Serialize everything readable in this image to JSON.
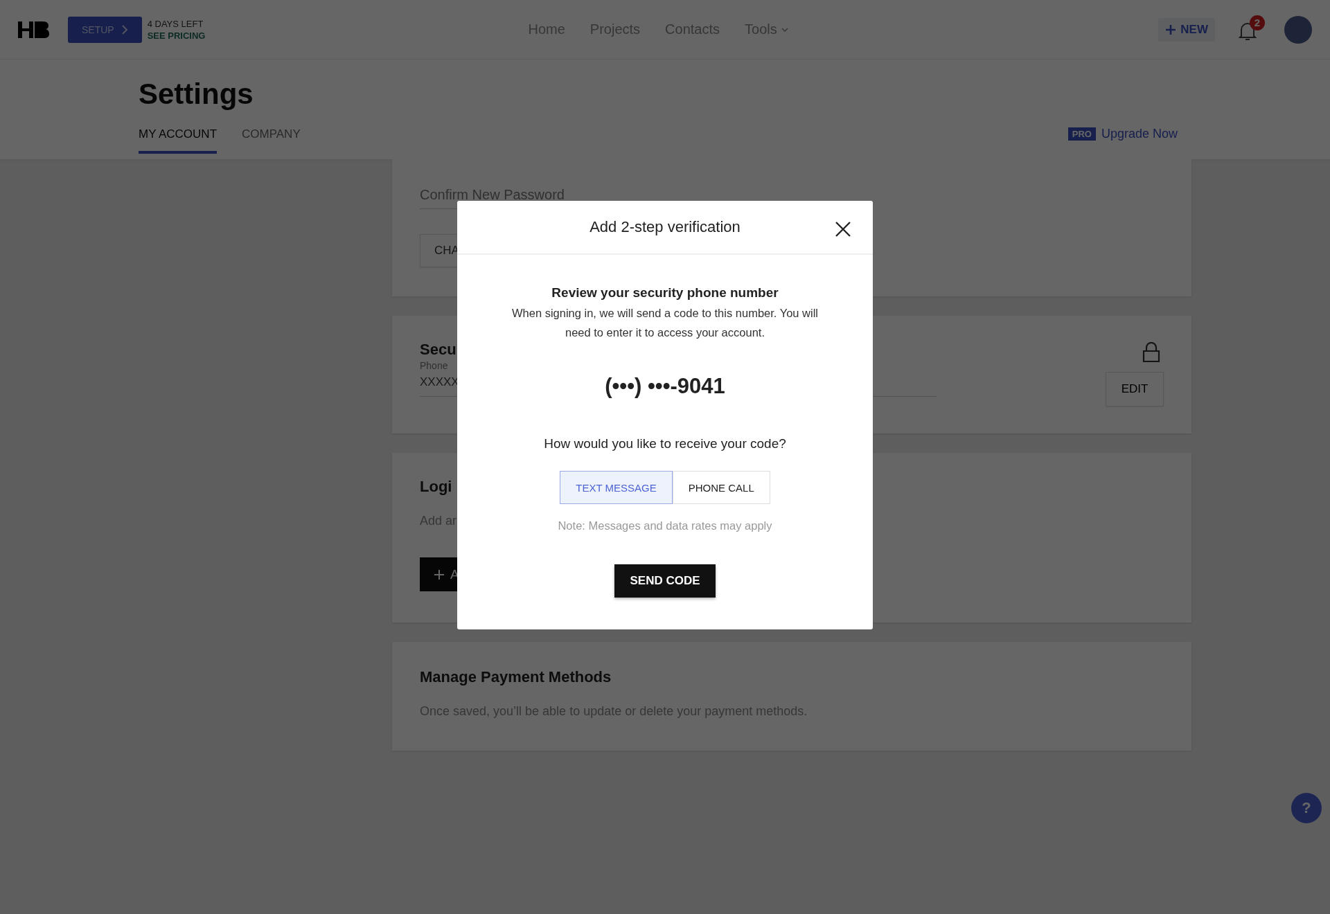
{
  "header": {
    "setup_button": "SETUP",
    "trial": {
      "days_left": "4 DAYS LEFT",
      "pricing_link": "SEE PRICING"
    },
    "nav": [
      {
        "label": "Home",
        "has_menu": false
      },
      {
        "label": "Projects",
        "has_menu": false
      },
      {
        "label": "Contacts",
        "has_menu": false
      },
      {
        "label": "Tools",
        "has_menu": true
      }
    ],
    "new_button": "NEW",
    "notifications_badge": "2"
  },
  "page": {
    "title": "Settings",
    "tabs": [
      {
        "label": "MY ACCOUNT",
        "selected": true
      },
      {
        "label": "COMPANY",
        "selected": false
      }
    ],
    "upgrade": {
      "badge": "PRO",
      "link": "Upgrade Now"
    }
  },
  "password_card": {
    "field_placeholder": "Confirm New Password",
    "button": "CHA"
  },
  "security_card": {
    "title": "Secu",
    "field_label": "Phone",
    "value": "XXXXX",
    "edit_button": "EDIT"
  },
  "login_card": {
    "title": "Logi",
    "description": "Add ar",
    "button": "A"
  },
  "payment_card": {
    "title": "Manage Payment Methods",
    "description": "Once saved, you’ll be able to update or delete your payment methods."
  },
  "modal": {
    "title": "Add 2-step verification",
    "heading": "Review your security phone number",
    "description": "When signing in, we will send a code to this number. You will need to enter it to access your account.",
    "phone": "(•••) •••-9041",
    "question": "How would you like to receive your code?",
    "options": [
      {
        "label": "TEXT MESSAGE",
        "selected": true
      },
      {
        "label": "PHONE CALL",
        "selected": false
      }
    ],
    "note": "Note: Messages and data rates may apply",
    "send_button": "SEND CODE"
  },
  "help_button": "?"
}
